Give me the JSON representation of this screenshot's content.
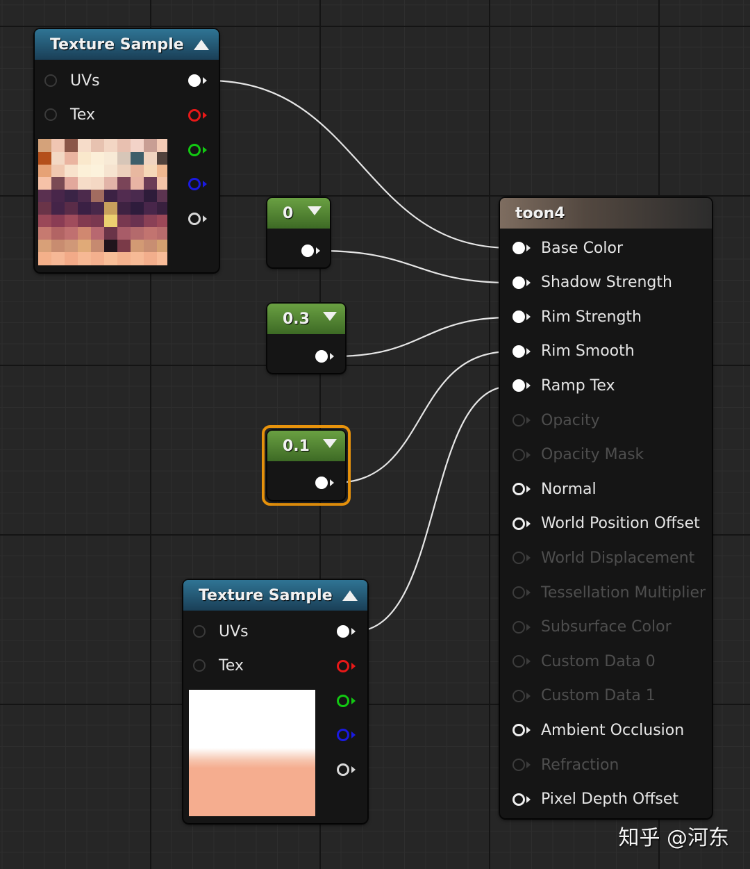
{
  "texture_sample_1": {
    "title": "Texture Sample",
    "inputs": [
      "UVs",
      "Tex"
    ],
    "output_colors": [
      "#ffffff",
      "#e81818",
      "#12c812",
      "#1a1ae0",
      "#d8d8d8"
    ]
  },
  "constant_a": {
    "value": "0"
  },
  "constant_b": {
    "value": "0.3"
  },
  "constant_c": {
    "value": "0.1"
  },
  "material": {
    "title": "toon4",
    "pins": [
      {
        "label": "Base Color",
        "state": "connected"
      },
      {
        "label": "Shadow Strength",
        "state": "connected"
      },
      {
        "label": "Rim Strength",
        "state": "connected"
      },
      {
        "label": "Rim Smooth",
        "state": "connected"
      },
      {
        "label": "Ramp Tex",
        "state": "connected"
      },
      {
        "label": "Opacity",
        "state": "disabled"
      },
      {
        "label": "Opacity Mask",
        "state": "disabled"
      },
      {
        "label": "Normal",
        "state": "open"
      },
      {
        "label": "World Position Offset",
        "state": "open"
      },
      {
        "label": "World Displacement",
        "state": "disabled"
      },
      {
        "label": "Tessellation Multiplier",
        "state": "disabled"
      },
      {
        "label": "Subsurface Color",
        "state": "disabled"
      },
      {
        "label": "Custom Data 0",
        "state": "disabled"
      },
      {
        "label": "Custom Data 1",
        "state": "disabled"
      },
      {
        "label": "Ambient Occlusion",
        "state": "open"
      },
      {
        "label": "Refraction",
        "state": "disabled"
      },
      {
        "label": "Pixel Depth Offset",
        "state": "open"
      }
    ]
  },
  "texture_sample_2": {
    "title": "Texture Sample",
    "inputs": [
      "UVs",
      "Tex"
    ],
    "output_colors": [
      "#ffffff",
      "#e81818",
      "#12c812",
      "#1a1ae0",
      "#d8d8d8"
    ]
  },
  "colors": {
    "selection": "#e8930c",
    "wire": "#e6e6e6",
    "ramp_bottom": "#f5ad8f"
  },
  "watermark": "知乎 @河东"
}
